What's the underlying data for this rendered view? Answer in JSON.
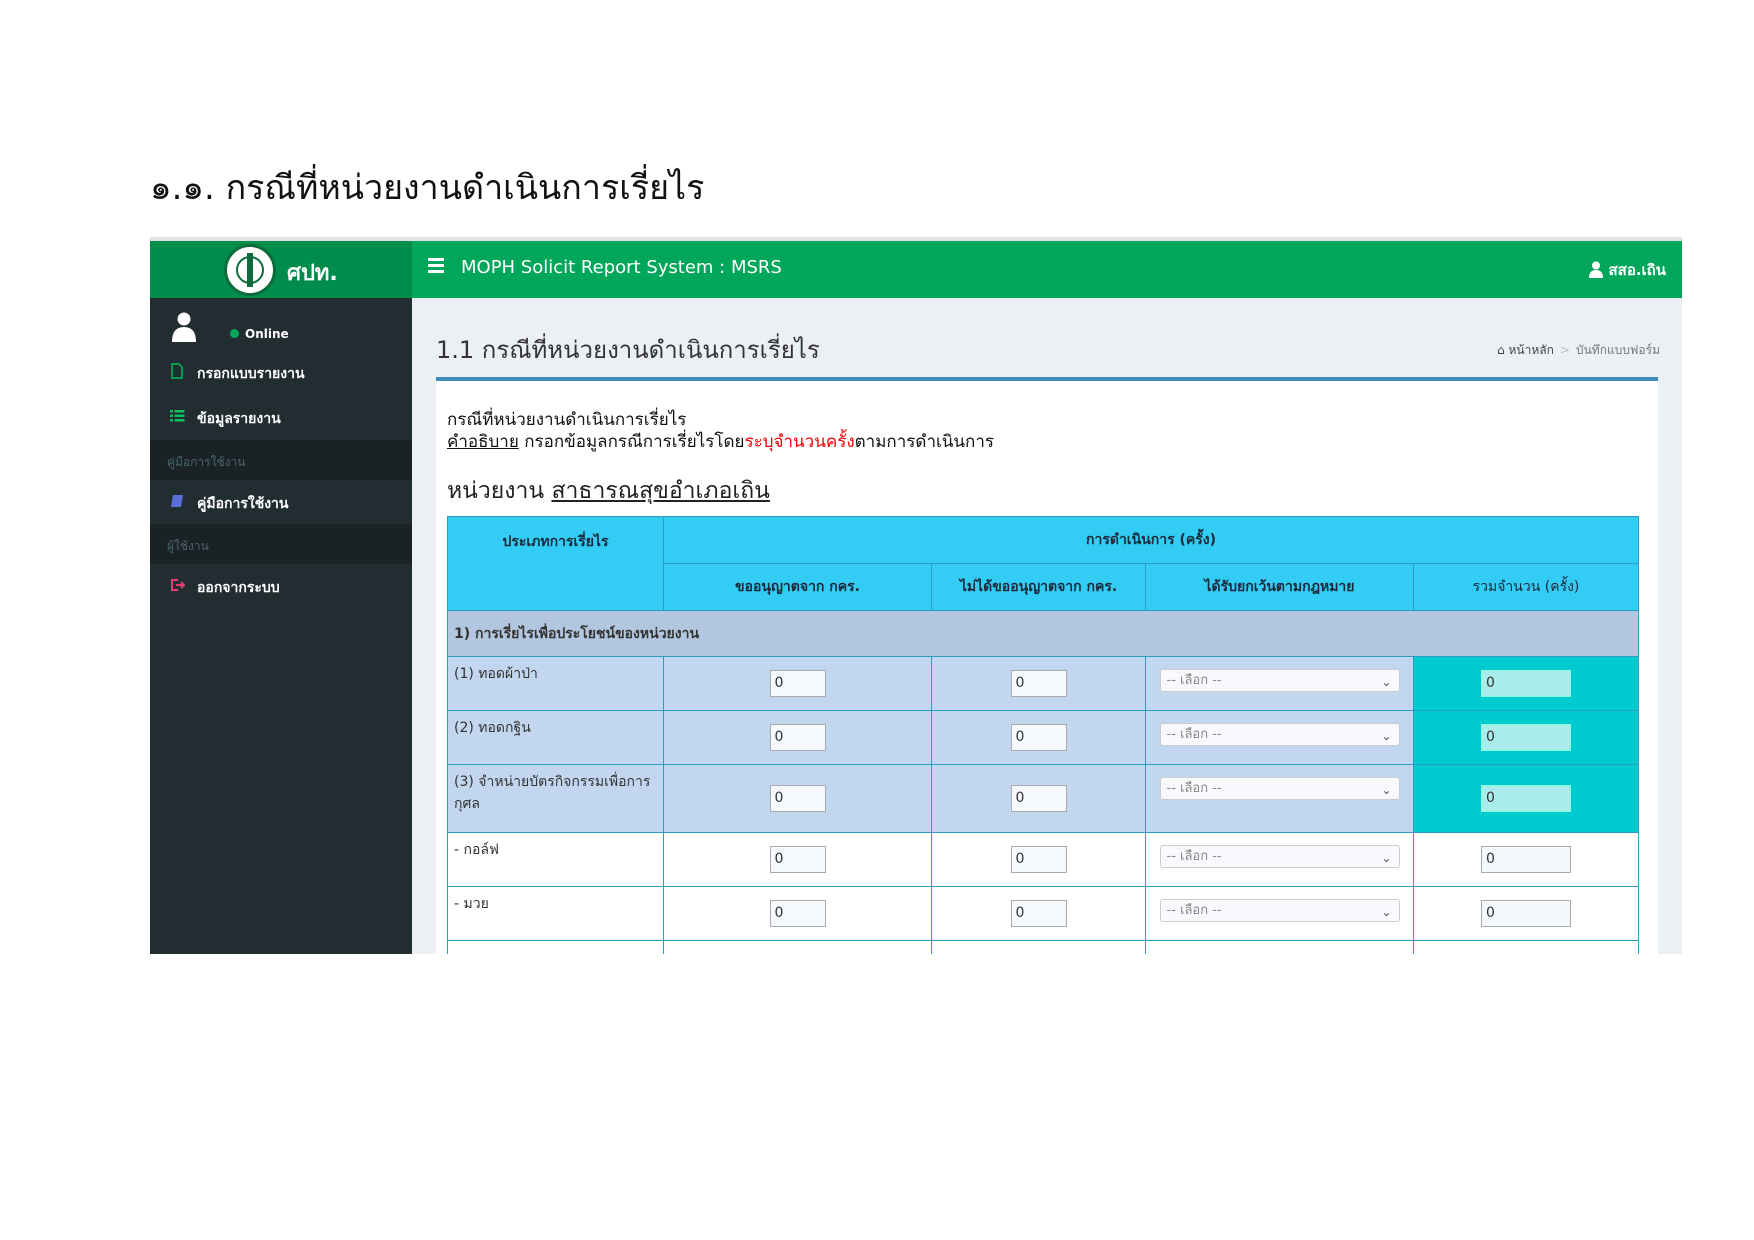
{
  "document": {
    "heading": "๑.๑. กรณีที่หน่วยงานดำเนินการเรี่ยไร"
  },
  "topbar": {
    "logo_text": "ศปท.",
    "system_title": "MOPH Solicit Report System : MSRS",
    "user_name": "สสอ.เถิน"
  },
  "sidebar": {
    "status": "Online",
    "items": [
      {
        "label": "กรอกแบบรายงาน",
        "icon": "file-icon"
      },
      {
        "label": "ข้อมูลรายงาน",
        "icon": "list-icon"
      }
    ],
    "manual_header": "คู่มือการใช้งาน",
    "manual_item": {
      "label": "คู่มือการใช้งาน",
      "icon": "book-icon"
    },
    "user_header": "ผู้ใช้งาน",
    "logout_item": {
      "label": "ออกจากระบบ",
      "icon": "sign-out-icon"
    }
  },
  "page": {
    "title": "1.1 กรณีที่หน่วยงานดำเนินการเรี่ยไร",
    "breadcrumb": {
      "home": "หน้าหลัก",
      "current": "บันทึกแบบฟอร์ม"
    },
    "desc_line1": "กรณีที่หน่วยงานดำเนินการเรี่ยไร",
    "desc_label": "คำอธิบาย",
    "desc_text_a": " กรอกข้อมูลกรณีการเรี่ยไรโดย",
    "desc_text_red": "ระบุจำนวนครั้ง",
    "desc_text_b": "ตามการดำเนินการ",
    "unit_label": "หน่วยงาน ",
    "unit_name": "สาธารณสุขอำเภอเถิน"
  },
  "table": {
    "headers": {
      "type": "ประเภทการเรี่ยไร",
      "operation": "การดำเนินการ (ครั้ง)",
      "col1": "ขออนุญาตจาก กคร.",
      "col2": "ไม่ได้ขออนุญาตจาก กคร.",
      "col3": "ได้รับยกเว้นตามกฎหมาย",
      "col4": "รวมจำนวน (ครั้ง)"
    },
    "group_label": "1) การเรี่ยไรเพื่อประโยชน์ของหน่วยงาน",
    "select_placeholder": "-- เลือก --",
    "rows": [
      {
        "label": "(1) ทอดผ้าป่า",
        "v1": "0",
        "v2": "0",
        "total": "0"
      },
      {
        "label": "(2) ทอดกฐิน",
        "v1": "0",
        "v2": "0",
        "total": "0"
      },
      {
        "label": "(3) จำหน่ายบัตรกิจกรรมเพื่อการกุศล",
        "v1": "0",
        "v2": "0",
        "total": "0"
      },
      {
        "label": "- กอล์ฟ",
        "v1": "0",
        "v2": "0",
        "total": "0"
      },
      {
        "label": "- มวย",
        "v1": "0",
        "v2": "0",
        "total": "0"
      }
    ]
  }
}
